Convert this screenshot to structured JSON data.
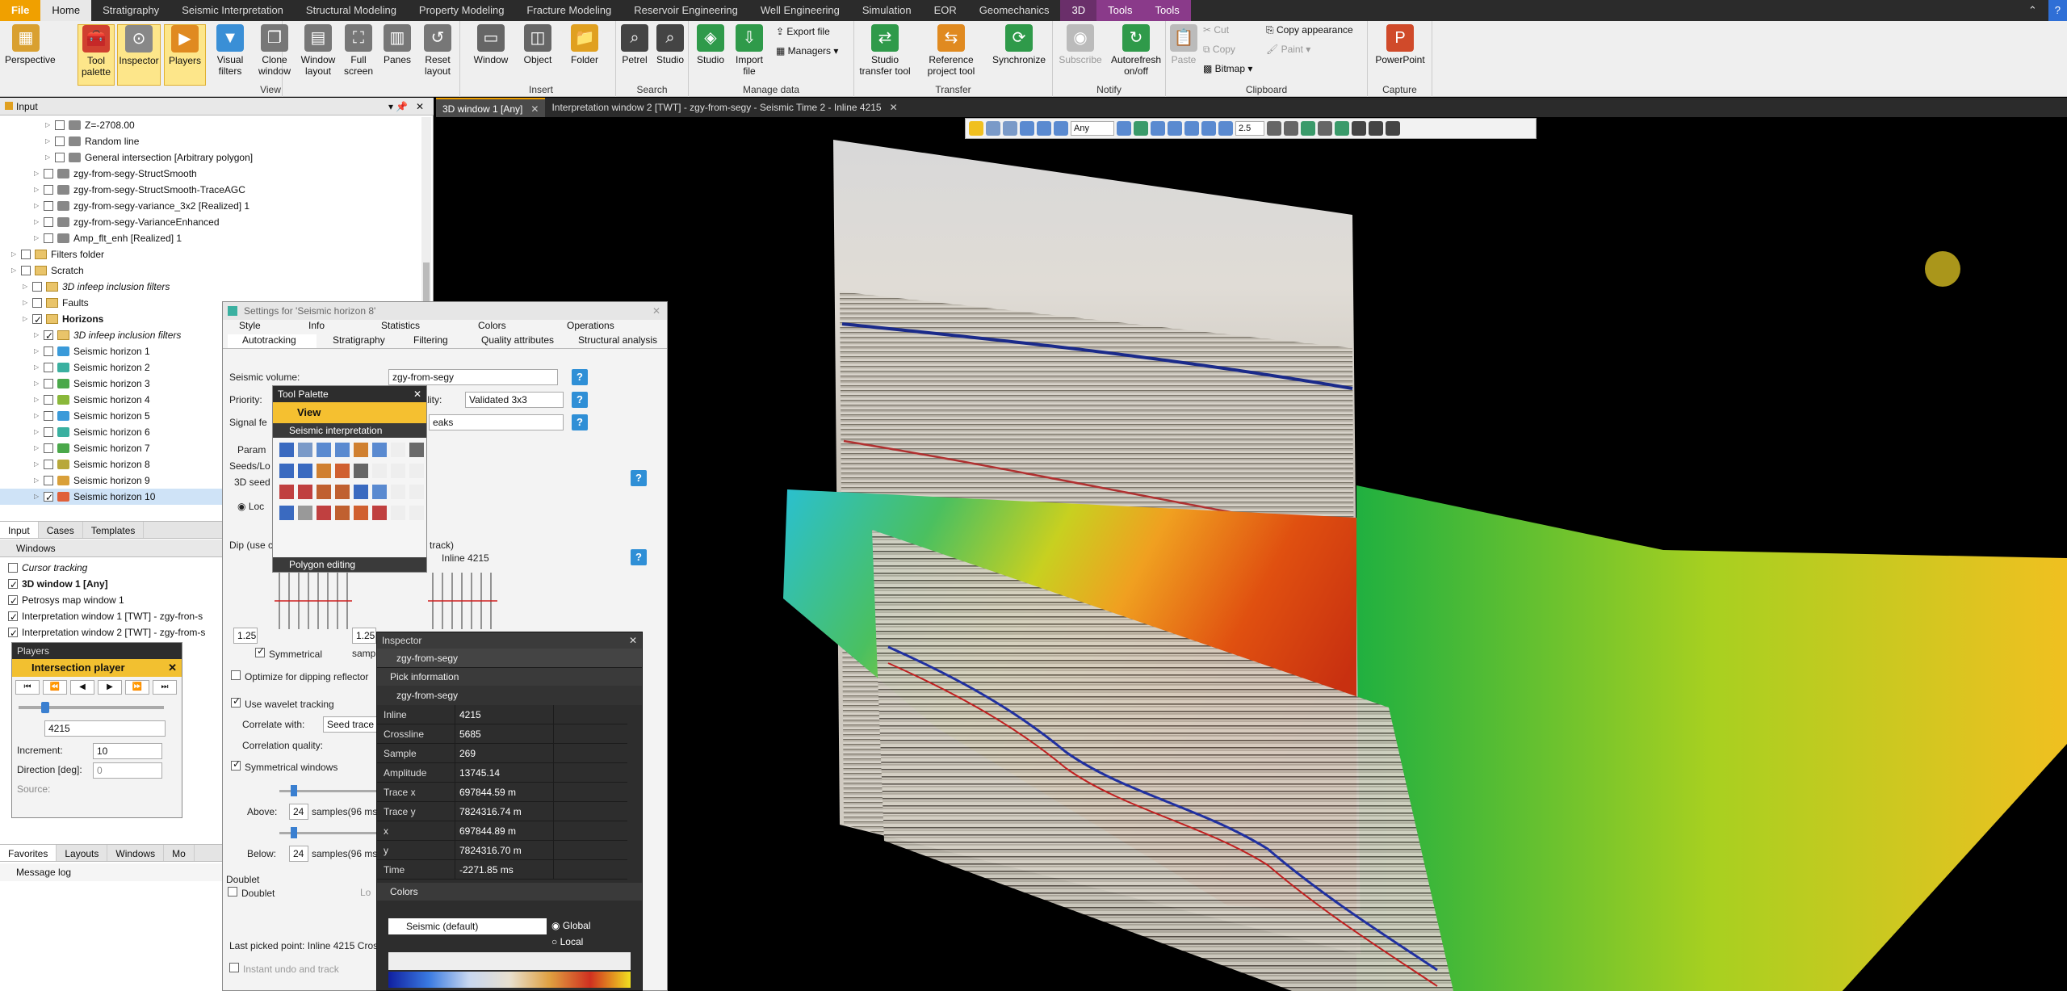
{
  "menubar": {
    "tabs": [
      "File",
      "Home",
      "Stratigraphy",
      "Seismic Interpretation",
      "Structural Modeling",
      "Property Modeling",
      "Fracture Modeling",
      "Reservoir Engineering",
      "Well Engineering",
      "Simulation",
      "EOR",
      "Geomechanics",
      "3D",
      "Tools",
      "Tools"
    ]
  },
  "ribbon": {
    "groups": {
      "view": "View",
      "insert": "Insert",
      "search": "Search",
      "manage": "Manage data",
      "transfer": "Transfer",
      "notify": "Notify",
      "clipboard": "Clipboard",
      "capture": "Capture"
    },
    "buttons": {
      "perspective": "Perspective",
      "tool_palette": "Tool palette",
      "inspector": "Inspector",
      "players": "Players",
      "visual_filters": "Visual filters",
      "clone_window": "Clone window",
      "window_layout": "Window layout",
      "full_screen": "Full screen",
      "panes": "Panes",
      "reset_layout": "Reset layout",
      "window": "Window",
      "object": "Object",
      "folder": "Folder",
      "petrel": "Petrel",
      "studio": "Studio",
      "studio2": "Studio",
      "import_file": "Import file",
      "export_file": "Export file",
      "managers": "Managers",
      "studio_transfer": "Studio transfer tool",
      "reference_project": "Reference project tool",
      "synchronize": "Synchronize",
      "subscribe": "Subscribe",
      "autorefresh": "Autorefresh on/off",
      "paste": "Paste",
      "cut": "Cut",
      "copy": "Copy",
      "bitmap": "Bitmap",
      "copy_appearance": "Copy appearance",
      "paint": "Paint",
      "powerpoint": "PowerPoint"
    }
  },
  "input_pane": {
    "title": "Input",
    "tree": [
      {
        "label": "Z=-2708.00",
        "indent": 4,
        "icon": "plane"
      },
      {
        "label": "Random line",
        "indent": 4,
        "icon": "line"
      },
      {
        "label": "General intersection [Arbitrary polygon]",
        "indent": 4,
        "icon": "plane"
      },
      {
        "label": "zgy-from-segy-StructSmooth",
        "indent": 3,
        "icon": "cube"
      },
      {
        "label": "zgy-from-segy-StructSmooth-TraceAGC",
        "indent": 3,
        "icon": "cube"
      },
      {
        "label": "zgy-from-segy-variance_3x2 [Realized] 1",
        "indent": 3,
        "icon": "cube"
      },
      {
        "label": "zgy-from-segy-VarianceEnhanced",
        "indent": 3,
        "icon": "cube"
      },
      {
        "label": "Amp_flt_enh [Realized] 1",
        "indent": 3,
        "icon": "cube"
      },
      {
        "label": "Filters folder",
        "indent": 1,
        "icon": "folder"
      },
      {
        "label": "Scratch",
        "indent": 1,
        "icon": "folder"
      },
      {
        "label": "3D infeep inclusion filters",
        "indent": 2,
        "icon": "folder",
        "italic": true
      },
      {
        "label": "Faults",
        "indent": 2,
        "icon": "folder"
      },
      {
        "label": "Horizons",
        "indent": 2,
        "icon": "folder",
        "bold": true,
        "checked": true
      },
      {
        "label": "3D infeep inclusion filters",
        "indent": 3,
        "icon": "folder",
        "italic": true,
        "checked": true
      },
      {
        "label": "Seismic horizon 1",
        "indent": 3,
        "icon": "hz",
        "color": "#3a9ad9"
      },
      {
        "label": "Seismic horizon 2",
        "indent": 3,
        "icon": "hz",
        "color": "#3ab0a0"
      },
      {
        "label": "Seismic horizon 3",
        "indent": 3,
        "icon": "hz",
        "color": "#4aa84a"
      },
      {
        "label": "Seismic horizon 4",
        "indent": 3,
        "icon": "hz",
        "color": "#8ab83a"
      },
      {
        "label": "Seismic horizon 5",
        "indent": 3,
        "icon": "hz",
        "color": "#3a9ad9"
      },
      {
        "label": "Seismic horizon 6",
        "indent": 3,
        "icon": "hz",
        "color": "#3ab0a0"
      },
      {
        "label": "Seismic horizon 7",
        "indent": 3,
        "icon": "hz",
        "color": "#4aa84a"
      },
      {
        "label": "Seismic horizon 8",
        "indent": 3,
        "icon": "hz",
        "color": "#b8a83a"
      },
      {
        "label": "Seismic horizon 9",
        "indent": 3,
        "icon": "hz",
        "color": "#d9a03a"
      },
      {
        "label": "Seismic horizon 10",
        "indent": 3,
        "icon": "hz",
        "color": "#e0603a",
        "selected": true,
        "checked": true
      }
    ],
    "tabs": [
      "Input",
      "Cases",
      "Templates"
    ]
  },
  "windows_pane": {
    "title": "Windows",
    "items": [
      {
        "label": "Cursor tracking",
        "italic": true
      },
      {
        "label": "3D window 1 [Any]",
        "bold": true
      },
      {
        "label": "Petrosys map window 1"
      },
      {
        "label": "Interpretation window 1 [TWT] - zgy-fron-s"
      },
      {
        "label": "Interpretation window 2 [TWT] - zgy-from-s"
      }
    ]
  },
  "players": {
    "title": "Players",
    "header": "Intersection player",
    "value": "4215",
    "increment_label": "Increment:",
    "increment": "10",
    "direction_label": "Direction [deg]:",
    "direction": "0",
    "source_label": "Source:"
  },
  "bottom_tabs": [
    "Favorites",
    "Layouts",
    "Windows",
    "Mo"
  ],
  "message_log": "Message log",
  "view_tabs": [
    {
      "label": "3D window 1 [Any]",
      "selected": true
    },
    {
      "label": "Interpretation window 2 [TWT] - zgy-from-segy - Seismic Time 2 - Inline 4215",
      "selected": false
    }
  ],
  "viewtoolbar": {
    "any": "Any",
    "zoom": "2.5"
  },
  "settings": {
    "title": "Settings for 'Seismic horizon 8'",
    "tabs_row1": [
      "Style",
      "Info",
      "Statistics",
      "Colors",
      "Operations"
    ],
    "tabs_row2": [
      "Autotracking",
      "Stratigraphy",
      "Filtering",
      "Quality attributes",
      "Structural analysis"
    ],
    "seismic_volume_label": "Seismic volume:",
    "seismic_volume": "zgy-from-segy",
    "priority_label": "Priority:",
    "quality_label": "uality:",
    "quality": "Validated 3x3",
    "signal_label": "Signal fe",
    "signal_value": "eaks",
    "param_tab": "Param",
    "seeds_label": "Seeds/Lo",
    "seed_3d": "3D seed",
    "loc_label": "Loc",
    "dip_label": "Dip (use c",
    "track_label": "D track)",
    "inline_label": "Inline 4215",
    "val_125a": "1.25",
    "val_125b": "1.25",
    "symmetrical": "Symmetrical",
    "samples_short": "samp",
    "optimize": "Optimize for dipping reflector",
    "use_wavelet": "Use wavelet tracking",
    "correlate_label": "Correlate with:",
    "correlate_value": "Seed trace",
    "corr_quality": "Correlation quality:",
    "sym_windows": "Symmetrical windows",
    "above_label": "Above:",
    "above_val": "24",
    "below_label": "Below:",
    "below_val": "24",
    "samples_ms": "samples(96 ms)",
    "doublet_group": "Doublet",
    "doublet": "Doublet",
    "loc2": "Lo",
    "last_picked": "Last picked point: Inline 4215 Cros",
    "instant_undo": "Instant undo and track"
  },
  "tool_palette": {
    "title": "Tool Palette",
    "view": "View",
    "seismic_interp": "Seismic interpretation",
    "polygon_editing": "Polygon editing"
  },
  "inspector": {
    "title": "Inspector",
    "object": "zgy-from-segy",
    "pick_info": "Pick information",
    "sub_object": "zgy-from-segy",
    "rows": [
      {
        "k": "Inline",
        "v": "4215"
      },
      {
        "k": "Crossline",
        "v": "5685"
      },
      {
        "k": "Sample",
        "v": "269"
      },
      {
        "k": "Amplitude",
        "v": "13745.14"
      },
      {
        "k": "Trace x",
        "v": "697844.59 m"
      },
      {
        "k": "Trace y",
        "v": "7824316.74 m"
      },
      {
        "k": "x",
        "v": "697844.89 m"
      },
      {
        "k": "y",
        "v": "7824316.70 m"
      },
      {
        "k": "Time",
        "v": "-2271.85 ms"
      }
    ],
    "colors": "Colors",
    "colortable": "Seismic (default)",
    "global": "Global",
    "local": "Local"
  },
  "colors": {
    "accent": "#f0a000",
    "menubar": "#2b2b2b",
    "tools_tab": "#8a3a8a"
  }
}
